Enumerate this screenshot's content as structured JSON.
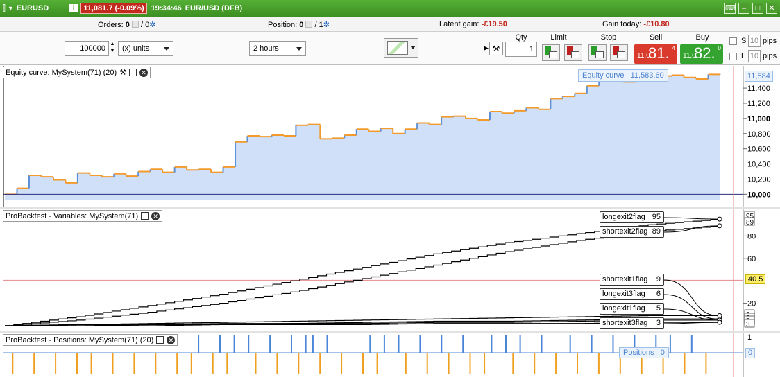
{
  "titlebar": {
    "symbol": "EURUSD",
    "price_chip": "11,081.7 (-0.09%)",
    "time": "19:34:46",
    "instrument": "EUR/USD (DFB)"
  },
  "infobar": {
    "orders_label": "Orders:",
    "orders_value": "0",
    "orders_sep": "/",
    "orders_total": "0",
    "position_label": "Position:",
    "position_value": "0",
    "position_sep": "/",
    "position_total": "1",
    "latent_label": "Latent gain:",
    "latent_value": "-£19.50",
    "today_label": "Gain today:",
    "today_value": "-£10.80"
  },
  "orderbar": {
    "quantity_value": "100000",
    "units_select": "(x) units",
    "timeframe_select": "2 hours",
    "qty_label": "Qty",
    "qty_value": "1",
    "limit_label": "Limit",
    "stop_label": "Stop",
    "sell_label": "Sell",
    "sell_small": "11,0",
    "sell_big": "81.",
    "sell_sup": "4",
    "buy_label": "Buy",
    "buy_small": "11,0",
    "buy_big": "82.",
    "buy_sup": "0",
    "s_label": "S",
    "l_label": "L",
    "s_pips": "10",
    "l_pips": "10",
    "pips_label": "pips",
    "sell_color": "#d93a2b",
    "buy_color": "#35a32f"
  },
  "equity_panel": {
    "title": "Equity curve: MySystem(71) (20)",
    "legend_label": "Equity curve",
    "legend_value": "11,583.60",
    "current_label": "11,584"
  },
  "variables_panel": {
    "title": "ProBacktest - Variables: MySystem(71)",
    "cursor_label": "40.5",
    "end_labels": [
      "95",
      "89",
      "9",
      "6",
      "5",
      "3"
    ],
    "flags": [
      {
        "name": "longexit2flag",
        "value": "95"
      },
      {
        "name": "shortexit2flag",
        "value": "89"
      },
      {
        "name": "shortexit1flag",
        "value": "9"
      },
      {
        "name": "longexit3flag",
        "value": "6"
      },
      {
        "name": "longexit1flag",
        "value": "5"
      },
      {
        "name": "shortexit3flag",
        "value": "3"
      }
    ]
  },
  "positions_panel": {
    "title": "ProBacktest - Positions: MySystem(71) (20)",
    "legend_label": "Positions",
    "legend_value": "0",
    "axis_top": "1",
    "axis_zero": "0"
  },
  "chart_data": [
    {
      "type": "area",
      "series_color": "#5b8fd8",
      "down_color": "#f39a2c",
      "fill_color": "#cfe0f8",
      "ylim": [
        9930,
        11620
      ],
      "y_ticks": [
        "10,000",
        "10,200",
        "10,400",
        "10,600",
        "10,800",
        "11,000",
        "11,200",
        "11,400"
      ],
      "values": [
        10000,
        10080,
        10250,
        10230,
        10190,
        10150,
        10280,
        10250,
        10230,
        10270,
        10240,
        10300,
        10330,
        10290,
        10360,
        10320,
        10330,
        10290,
        10360,
        10690,
        10770,
        10760,
        10780,
        10770,
        10910,
        10920,
        10730,
        10740,
        10780,
        10860,
        10830,
        10870,
        10800,
        10860,
        10940,
        10920,
        11020,
        11030,
        11000,
        10980,
        11090,
        11070,
        11100,
        11140,
        11120,
        11260,
        11290,
        11330,
        11430,
        11510,
        11560,
        11480,
        11500,
        11540,
        11560,
        11570,
        11540,
        11520,
        11580,
        11584
      ]
    },
    {
      "type": "line",
      "ylim": [
        0,
        100
      ],
      "y_ticks": [
        "20",
        "60",
        "80"
      ],
      "series": [
        {
          "name": "longexit2flag",
          "values": [
            0,
            8,
            18,
            28,
            40,
            52,
            64,
            74,
            82,
            90,
            95
          ]
        },
        {
          "name": "shortexit2flag",
          "values": [
            0,
            5,
            12,
            20,
            30,
            42,
            54,
            66,
            76,
            84,
            89
          ]
        },
        {
          "name": "shortexit1flag",
          "values": [
            0,
            1,
            2,
            3,
            4,
            5,
            6,
            7,
            8,
            9,
            9
          ]
        },
        {
          "name": "longexit3flag",
          "values": [
            0,
            1,
            1,
            2,
            2,
            3,
            4,
            4,
            5,
            6,
            6
          ]
        },
        {
          "name": "longexit1flag",
          "values": [
            0,
            0,
            1,
            1,
            2,
            2,
            3,
            3,
            4,
            5,
            5
          ]
        },
        {
          "name": "shortexit3flag",
          "values": [
            0,
            0,
            0,
            1,
            1,
            1,
            2,
            2,
            2,
            3,
            3
          ]
        }
      ]
    },
    {
      "type": "bar",
      "long_color": "#4a86d8",
      "short_color": "#f0a020",
      "ylim": [
        -1,
        1
      ],
      "long_positions": [
        0.27,
        0.3,
        0.32,
        0.34,
        0.37,
        0.4,
        0.42,
        0.43,
        0.45,
        0.51,
        0.53,
        0.55,
        0.58,
        0.61,
        0.64,
        0.68,
        0.7,
        0.72,
        0.75,
        0.79,
        0.82,
        0.85,
        0.88,
        0.91,
        0.93,
        0.96
      ],
      "short_positions": [
        0.01,
        0.04,
        0.07,
        0.1,
        0.12,
        0.15,
        0.18,
        0.21,
        0.24,
        0.26,
        0.29,
        0.31,
        0.35,
        0.38,
        0.41,
        0.44,
        0.47,
        0.5,
        0.52,
        0.56,
        0.59,
        0.62,
        0.65,
        0.67,
        0.71,
        0.74,
        0.77,
        0.8,
        0.83,
        0.86,
        0.89,
        0.92,
        0.95,
        0.98
      ]
    }
  ]
}
